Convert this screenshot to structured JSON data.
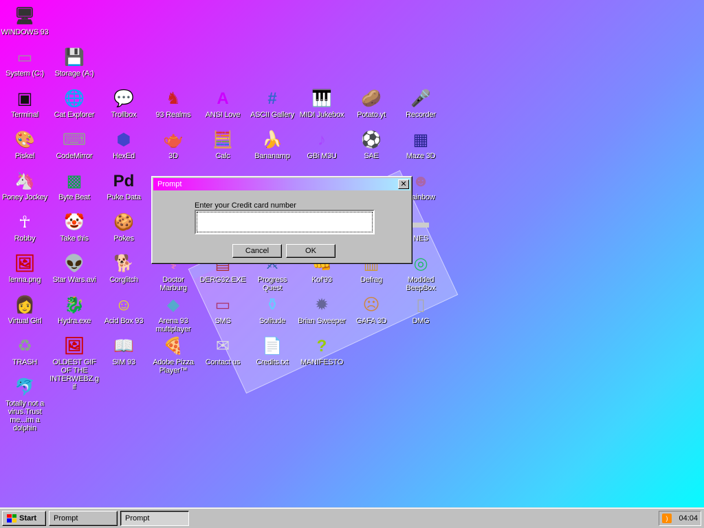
{
  "desktop": {
    "icons": [
      {
        "label": "WINDOWS 93",
        "icon": "computer-icon",
        "glyph": "🖥"
      },
      {
        "label": "System (C:)",
        "icon": "hard-drive-icon",
        "glyph": "▭"
      },
      {
        "label": "Storage (A:)",
        "icon": "floppy-drive-icon",
        "glyph": "💾"
      },
      {
        "label": "Terminal",
        "icon": "terminal-icon",
        "glyph": "▣"
      },
      {
        "label": "Cat Explorer",
        "icon": "globe-cat-icon",
        "glyph": "🌐"
      },
      {
        "label": "Trollbox",
        "icon": "chat-icon",
        "glyph": "💬"
      },
      {
        "label": "93 Realms",
        "icon": "knight-icon",
        "glyph": "♞"
      },
      {
        "label": "ANSI Love",
        "icon": "ansi-a-icon",
        "glyph": "A"
      },
      {
        "label": "ASCII Gallery",
        "icon": "ascii-123-icon",
        "glyph": "#"
      },
      {
        "label": "MIDI Jukebox",
        "icon": "piano-icon",
        "glyph": "🎹"
      },
      {
        "label": "Potato.yt",
        "icon": "potato-icon",
        "glyph": "🥔"
      },
      {
        "label": "Recorder",
        "icon": "microphone-icon",
        "glyph": "🎤"
      },
      {
        "label": "Piskel",
        "icon": "palette-icon",
        "glyph": "🎨"
      },
      {
        "label": "CodeMirror",
        "icon": "codemirror-icon",
        "glyph": "⌨"
      },
      {
        "label": "HexEd",
        "icon": "hex-cube-icon",
        "glyph": "⬢"
      },
      {
        "label": "3D",
        "icon": "teapot-icon",
        "glyph": "🫖"
      },
      {
        "label": "Calc",
        "icon": "calculator-icon",
        "glyph": "🧮"
      },
      {
        "label": "Bananamp",
        "icon": "banana-icon",
        "glyph": "🍌"
      },
      {
        "label": "GBi M3U",
        "icon": "audio-file-icon",
        "glyph": "♪"
      },
      {
        "label": "SAE",
        "icon": "checkered-ball-icon",
        "glyph": "⚽"
      },
      {
        "label": "Maze 3D",
        "icon": "maze-icon",
        "glyph": "▦"
      },
      {
        "label": "Poney Jockey",
        "icon": "pony-icon",
        "glyph": "🦄"
      },
      {
        "label": "Byte Beat",
        "icon": "bytebeat-icon",
        "glyph": "▩"
      },
      {
        "label": "Puke Data",
        "icon": "pd-icon",
        "glyph": "Pd"
      },
      {
        "label": "Rainbow",
        "icon": "rainbow-people-icon",
        "glyph": "☻"
      },
      {
        "label": "Robby",
        "icon": "stick-figure-icon",
        "glyph": "☥"
      },
      {
        "label": "Take this",
        "icon": "clown-icon",
        "glyph": "🤡"
      },
      {
        "label": "Pokes",
        "icon": "cookie-face-icon",
        "glyph": "🍪"
      },
      {
        "label": "NES",
        "icon": "nes-icon",
        "glyph": "▬"
      },
      {
        "label": "lenna.png",
        "icon": "image-file-icon",
        "glyph": "🖼"
      },
      {
        "label": "Star Wars.avi",
        "icon": "yoda-icon",
        "glyph": "👽"
      },
      {
        "label": "Corglitch",
        "icon": "corgi-icon",
        "glyph": "🐕"
      },
      {
        "label": "Doctor Marburg",
        "icon": "doctor-icon",
        "glyph": "⚕"
      },
      {
        "label": "DERG32.EXE",
        "icon": "derg-icon",
        "glyph": "▤"
      },
      {
        "label": "Progress Quest",
        "icon": "progress-quest-icon",
        "glyph": "⚔"
      },
      {
        "label": "Kof'93",
        "icon": "fighter-icon",
        "glyph": "👊"
      },
      {
        "label": "Defrag",
        "icon": "defrag-icon",
        "glyph": "▥"
      },
      {
        "label": "Modded BeepBox",
        "icon": "beepbox-ring-icon",
        "glyph": "◎"
      },
      {
        "label": "Virtual Girl",
        "icon": "face-icon",
        "glyph": "👩"
      },
      {
        "label": "Hydra.exe",
        "icon": "hydra-icon",
        "glyph": "🐉"
      },
      {
        "label": "Acid Box 93",
        "icon": "smiley-icon",
        "glyph": "☺"
      },
      {
        "label": "Arena 93 multiplayer",
        "icon": "cube-icon",
        "glyph": "◆"
      },
      {
        "label": "SMS",
        "icon": "sms-console-icon",
        "glyph": "▭"
      },
      {
        "label": "Solitude",
        "icon": "jar-icon",
        "glyph": "⚱"
      },
      {
        "label": "Brian Sweeper",
        "icon": "mine-icon",
        "glyph": "✹"
      },
      {
        "label": "GAFA 3D",
        "icon": "gafa-face-icon",
        "glyph": "☹"
      },
      {
        "label": "DMG",
        "icon": "dmg-gameboy-icon",
        "glyph": "▯"
      },
      {
        "label": "TRASH",
        "icon": "recycle-bin-icon",
        "glyph": "♻"
      },
      {
        "label": "OLDEST GIF OF THE INTERWEBZ.gif",
        "icon": "gif-file-icon",
        "glyph": "🖼"
      },
      {
        "label": "SIM 93",
        "icon": "book-icon",
        "glyph": "📖"
      },
      {
        "label": "Adobe Pizza Player™",
        "icon": "pizza-icon",
        "glyph": "🍕"
      },
      {
        "label": "Contact us",
        "icon": "letter-icon",
        "glyph": "✉"
      },
      {
        "label": "Credits.txt",
        "icon": "text-file-icon",
        "glyph": "📄"
      },
      {
        "label": "MANIFESTO",
        "icon": "question-mark-icon",
        "glyph": "?"
      },
      {
        "label": "Totally not a virus.Trust me...im a dolphin",
        "icon": "dolphin-shortcut-icon",
        "glyph": "🐬"
      }
    ]
  },
  "prompt": {
    "title": "Prompt",
    "close_glyph": "✕",
    "message": "Enter your Credit card number",
    "input_value": "",
    "cancel_label": "Cancel",
    "ok_label": "OK"
  },
  "taskbar": {
    "start_label": "Start",
    "tasks": [
      "Prompt",
      "Prompt"
    ],
    "active_task_index": 1,
    "clock": "04:04",
    "tray_icon": "rss-icon"
  },
  "colors": {
    "titlebar_start": "#ff00ff",
    "titlebar_end": "#a8f0ff",
    "face": "#c0c0c0"
  }
}
